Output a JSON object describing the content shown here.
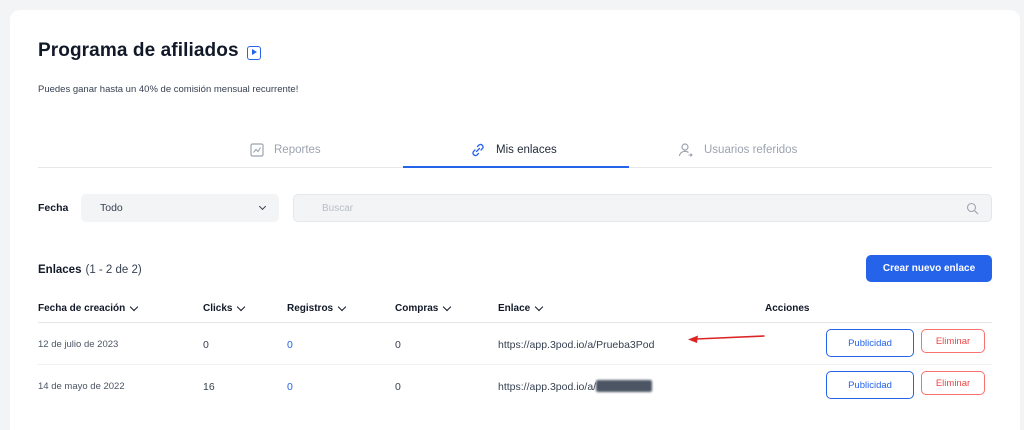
{
  "header": {
    "title": "Programa de afiliados",
    "title_icon": "play-square-icon",
    "subtitle": "Puedes ganar hasta un 40% de comisión mensual recurrente!"
  },
  "tabs": [
    {
      "label": "Reportes",
      "icon": "chart-report-icon",
      "active": false
    },
    {
      "label": "Mis enlaces",
      "icon": "link-icon",
      "active": true
    },
    {
      "label": "Usuarios referidos",
      "icon": "user-referral-icon",
      "active": false
    }
  ],
  "filters": {
    "date_label": "Fecha",
    "date_value": "Todo",
    "search_placeholder": "Buscar"
  },
  "links_section": {
    "title": "Enlaces",
    "count": "(1 - 2 de 2)",
    "create_button": "Crear nuevo enlace"
  },
  "table": {
    "headers": {
      "created": "Fecha de creación",
      "clicks": "Clicks",
      "registros": "Registros",
      "compras": "Compras",
      "enlace": "Enlace",
      "acciones": "Acciones"
    },
    "rows": [
      {
        "created": "12 de julio de 2023",
        "clicks": "0",
        "registros": "0",
        "compras": "0",
        "enlace": "https://app.3pod.io/a/Prueba3Pod",
        "publicidad": "Publicidad",
        "eliminar": "Eliminar"
      },
      {
        "created": "14 de mayo de 2022",
        "clicks": "16",
        "registros": "0",
        "compras": "0",
        "enlace": "https://app.3pod.io/a/",
        "publicidad": "Publicidad",
        "eliminar": "Eliminar"
      }
    ]
  },
  "colors": {
    "accent": "#2563eb",
    "danger": "#ef4444",
    "annotation_arrow": "#dc2626"
  }
}
